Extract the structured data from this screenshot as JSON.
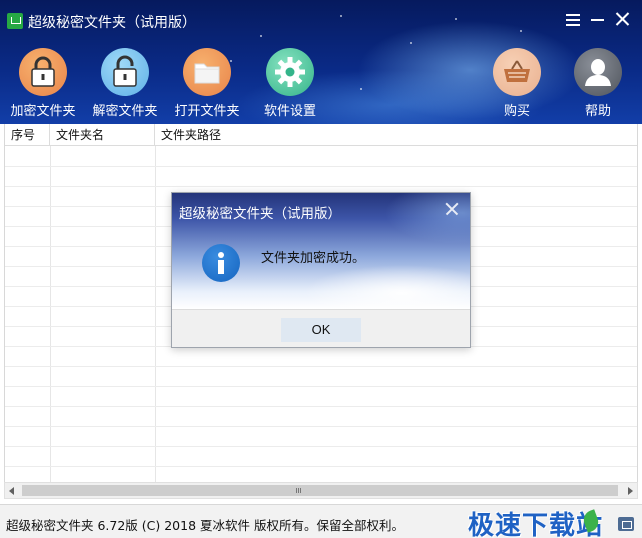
{
  "app": {
    "title": "超级秘密文件夹（试用版）"
  },
  "toolbar": {
    "items": [
      {
        "label": "加密文件夹",
        "icon": "lock-closed-icon",
        "color": "#f0a060"
      },
      {
        "label": "解密文件夹",
        "icon": "lock-open-icon",
        "color": "#7cc4ef"
      },
      {
        "label": "打开文件夹",
        "icon": "folder-icon",
        "color": "#f0a060"
      },
      {
        "label": "软件设置",
        "icon": "gear-icon",
        "color": "#5ccaa2"
      },
      {
        "label": "购买",
        "icon": "shopping-basket-icon",
        "color": "#f0c0a0"
      },
      {
        "label": "帮助",
        "icon": "user-help-icon",
        "color": "#6a6f78"
      }
    ]
  },
  "table": {
    "columns": [
      "序号",
      "文件夹名",
      "文件夹路径"
    ],
    "rows": []
  },
  "dialog": {
    "title": "超级秘密文件夹（试用版）",
    "message": "文件夹加密成功。",
    "ok_label": "OK",
    "icon": "info-icon"
  },
  "status": {
    "text": "超级秘密文件夹 6.72版 (C) 2018 夏冰软件 版权所有。保留全部权利。"
  },
  "watermark": {
    "text": "极速下载站"
  },
  "colors": {
    "header_dark": "#061a5e",
    "header_light": "#123ea8",
    "watermark": "#1f62c4",
    "info_blue": "#1565c0"
  }
}
